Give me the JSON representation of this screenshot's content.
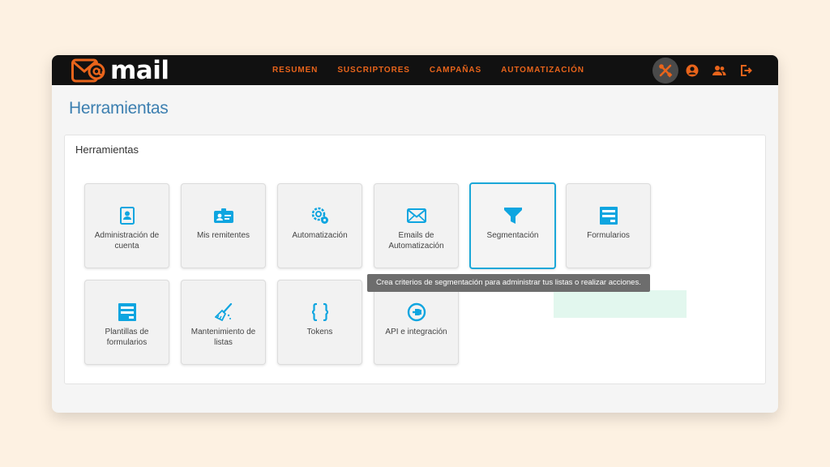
{
  "brand": {
    "at": "@",
    "word": "mail"
  },
  "nav": [
    "RESUMEN",
    "SUSCRIPTORES",
    "CAMPAÑAS",
    "AUTOMATIZACIÓN"
  ],
  "page_title": "Herramientas",
  "card_title": "Herramientas",
  "tiles": [
    {
      "label": "Administración de cuenta",
      "icon": "account-admin-icon",
      "selected": false
    },
    {
      "label": "Mis remitentes",
      "icon": "sender-id-icon",
      "selected": false
    },
    {
      "label": "Automatización",
      "icon": "automation-gears-icon",
      "selected": false
    },
    {
      "label": "Emails de Automatización",
      "icon": "envelope-icon",
      "selected": false
    },
    {
      "label": "Segmentación",
      "icon": "funnel-icon",
      "selected": true
    },
    {
      "label": "Formularios",
      "icon": "form-icon",
      "selected": false
    },
    {
      "label": "Plantillas de formularios",
      "icon": "form-template-icon",
      "selected": false
    },
    {
      "label": "Mantenimiento de listas",
      "icon": "broom-icon",
      "selected": false
    },
    {
      "label": "Tokens",
      "icon": "curly-braces-icon",
      "selected": false
    },
    {
      "label": "API e integración",
      "icon": "plug-icon",
      "selected": false
    }
  ],
  "tooltip": "Crea criterios de segmentación para administrar tus listas o realizar acciones.",
  "colors": {
    "accent": "#e8641b",
    "icon_blue": "#0ea5e0",
    "title_blue": "#3c7fb0",
    "topbar": "#111111"
  }
}
